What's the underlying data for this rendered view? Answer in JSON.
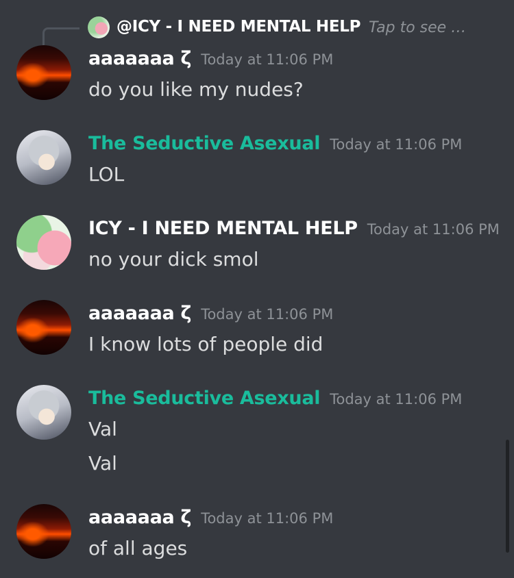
{
  "reply": {
    "author": "@ICY - I NEED MENTAL HELP",
    "snippet": "Tap to see …"
  },
  "messages": [
    {
      "author": "aaaaaaa ζ",
      "timestamp": "Today at 11:06 PM",
      "lines": [
        "do you like my nudes?"
      ]
    },
    {
      "author": "The Seductive Asexual",
      "timestamp": "Today at 11:06 PM",
      "lines": [
        "LOL"
      ]
    },
    {
      "author": "ICY - I NEED MENTAL HELP",
      "timestamp": "Today at 11:06 PM",
      "lines": [
        "no your dick smol"
      ]
    },
    {
      "author": "aaaaaaa ζ",
      "timestamp": "Today at 11:06 PM",
      "lines": [
        "I know lots of people did"
      ]
    },
    {
      "author": "The Seductive Asexual",
      "timestamp": "Today at 11:06 PM",
      "lines": [
        "Val",
        "Val"
      ]
    },
    {
      "author": "aaaaaaa ζ",
      "timestamp": "Today at 11:06 PM",
      "lines": [
        "of all ages"
      ]
    }
  ],
  "colors": {
    "background": "#36393f",
    "author_default": "#ffffff",
    "author_teal": "#1abc9c",
    "timestamp": "#8e9297",
    "message_text": "#dcddde"
  }
}
